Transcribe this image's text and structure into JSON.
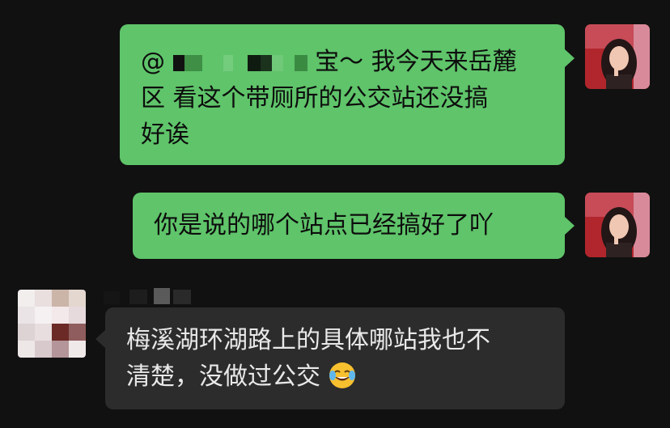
{
  "messages": [
    {
      "sender": "self",
      "mention": "@",
      "line1": "宝～ 我今天来岳麓",
      "line2": "区 看这个带厕所的公交站还没搞",
      "line3": "好诶"
    },
    {
      "sender": "self",
      "text": "你是说的哪个站点已经搞好了吖"
    },
    {
      "sender": "other",
      "line1": "梅溪湖环湖路上的具体哪站我也不",
      "line2": "清楚，没做过公交",
      "emoji": "face-with-tears-of-joy-icon"
    }
  ],
  "colors": {
    "background": "#111111",
    "outgoing_bubble": "#5fc46a",
    "incoming_bubble": "#2c2c2c"
  }
}
